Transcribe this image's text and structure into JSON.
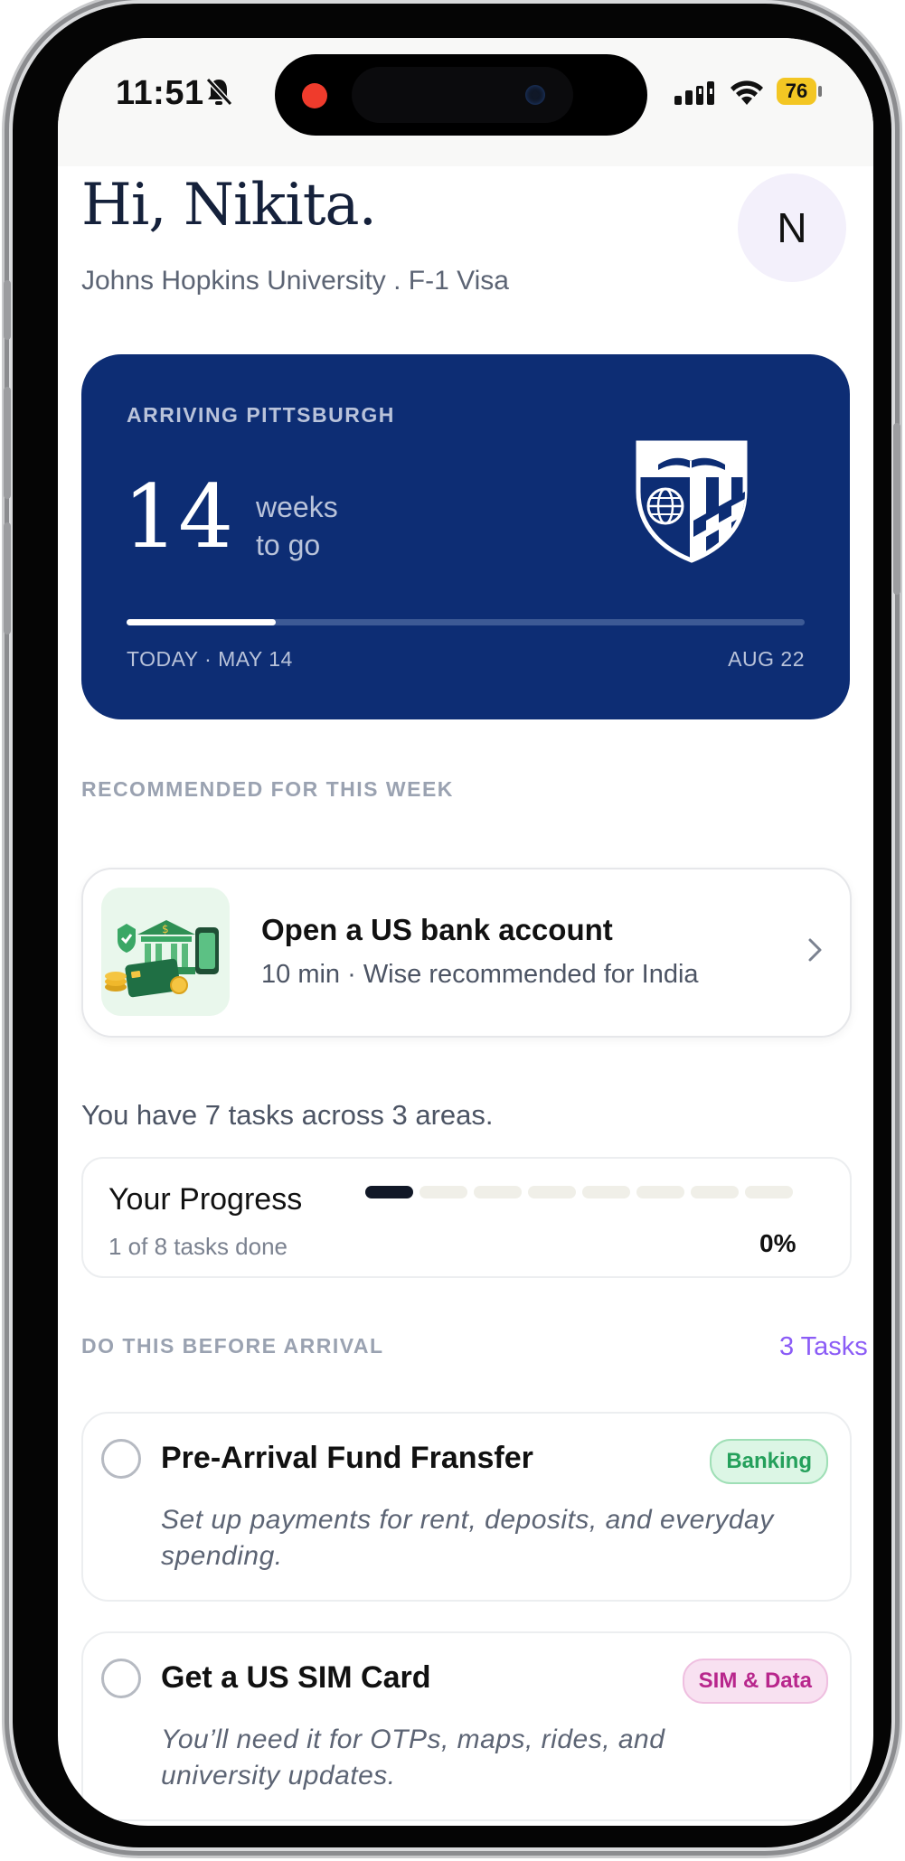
{
  "status_bar": {
    "time": "11:51",
    "battery": "76"
  },
  "header": {
    "greeting": "Hi, Nikita.",
    "subtitle": "Johns Hopkins University  .  F-1 Visa",
    "avatar_initial": "N"
  },
  "countdown": {
    "label": "ARRIVING PITTSBURGH",
    "number": "14",
    "unit_line1": "weeks",
    "unit_line2": "to go",
    "start_label": "TODAY · MAY 14",
    "end_label": "AUG 22",
    "progress_fraction": 0.22,
    "background_color": "#0d2d74"
  },
  "recommended": {
    "section_title": "RECOMMENDED FOR THIS WEEK",
    "title": "Open a US bank account",
    "subtitle": "10 min · Wise recommended for India"
  },
  "summary": "You have 7 tasks across 3 areas.",
  "progress": {
    "title": "Your Progress",
    "subtitle": "1 of 8 tasks done",
    "percent": "0%",
    "segments_total": 8,
    "segments_done": 1
  },
  "before_arrival": {
    "section_title": "DO THIS BEFORE ARRIVAL",
    "count_label": "3 Tasks",
    "tasks": [
      {
        "title": "Pre-Arrival Fund Fransfer",
        "badge": "Banking",
        "description": "Set up payments for rent, deposits, and everyday spending."
      },
      {
        "title": "Get a US SIM Card",
        "badge": "SIM & Data",
        "description": "You’ll need it for OTPs, maps, rides, and university updates."
      }
    ]
  },
  "colors": {
    "accent_purple": "#8b5cf6",
    "banking_green": "#24a05b",
    "sim_pink": "#b8268c"
  }
}
